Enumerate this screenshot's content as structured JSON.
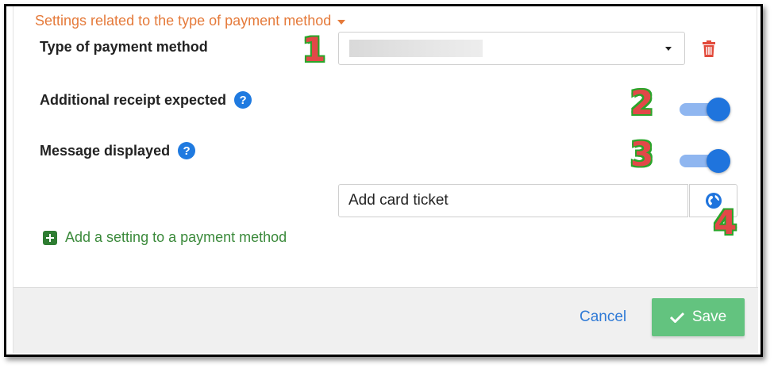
{
  "section_header": "Settings related to the type of payment method",
  "fields": {
    "payment_type_label": "Type of payment method",
    "additional_receipt_label": "Additional receipt expected",
    "message_displayed_label": "Message displayed",
    "help_glyph": "?"
  },
  "payment_type_select": {
    "value": ""
  },
  "toggles": {
    "additional_receipt": {
      "state": "on"
    },
    "message_displayed": {
      "state": "on"
    }
  },
  "message_input": {
    "value": "Add card ticket"
  },
  "add_setting_link": "Add a setting to a payment method",
  "annotations": [
    "1",
    "2",
    "3",
    "4"
  ],
  "footer": {
    "cancel_label": "Cancel",
    "save_label": "Save"
  },
  "icons": {
    "dropdown_caret": "caret-down-icon",
    "delete": "trash-icon",
    "help": "help-icon",
    "translate": "globe-icon",
    "add": "plus-square-icon",
    "save": "check-icon"
  },
  "colors": {
    "header_orange": "#e57a3a",
    "toggle_blue": "#1f74dd",
    "delete_red": "#e24a3b",
    "save_green": "#63c37f",
    "link_green": "#3b8a3b",
    "cancel_blue": "#2f7ad6"
  }
}
